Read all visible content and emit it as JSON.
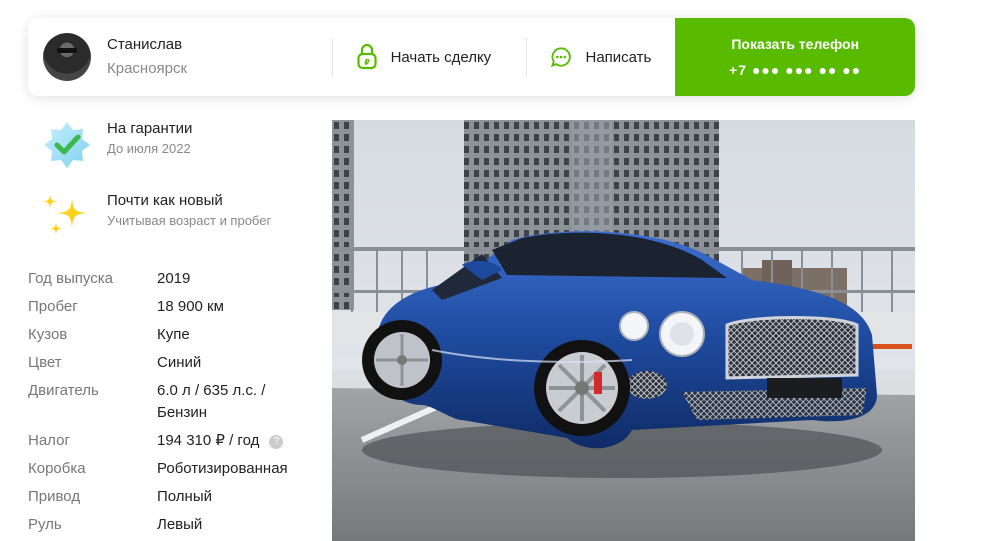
{
  "seller": {
    "name": "Станислав",
    "city": "Красноярск"
  },
  "actions": {
    "deal_label": "Начать сделку",
    "write_label": "Написать",
    "phone_title": "Показать телефон",
    "phone_masked": "+7 ●●● ●●● ●● ●●"
  },
  "badges": [
    {
      "title": "На гарантии",
      "subtitle": "До июля 2022",
      "icon": "star-check-icon"
    },
    {
      "title": "Почти как новый",
      "subtitle": "Учитывая возраст и пробег",
      "icon": "sparkles-icon"
    }
  ],
  "specs": [
    {
      "key": "Год выпуска",
      "value": "2019"
    },
    {
      "key": "Пробег",
      "value": "18 900 км"
    },
    {
      "key": "Кузов",
      "value": "Купе"
    },
    {
      "key": "Цвет",
      "value": "Синий"
    },
    {
      "key": "Двигатель",
      "value": "6.0 л / 635 л.с. /",
      "value2": "Бензин"
    },
    {
      "key": "Налог",
      "value": "194 310 ₽ / год",
      "help": "?"
    },
    {
      "key": "Коробка",
      "value": "Роботизированная"
    },
    {
      "key": "Привод",
      "value": "Полный"
    },
    {
      "key": "Руль",
      "value": "Левый"
    }
  ],
  "colors": {
    "accent_green": "#58bb00",
    "car_blue": "#1e4a9e"
  }
}
